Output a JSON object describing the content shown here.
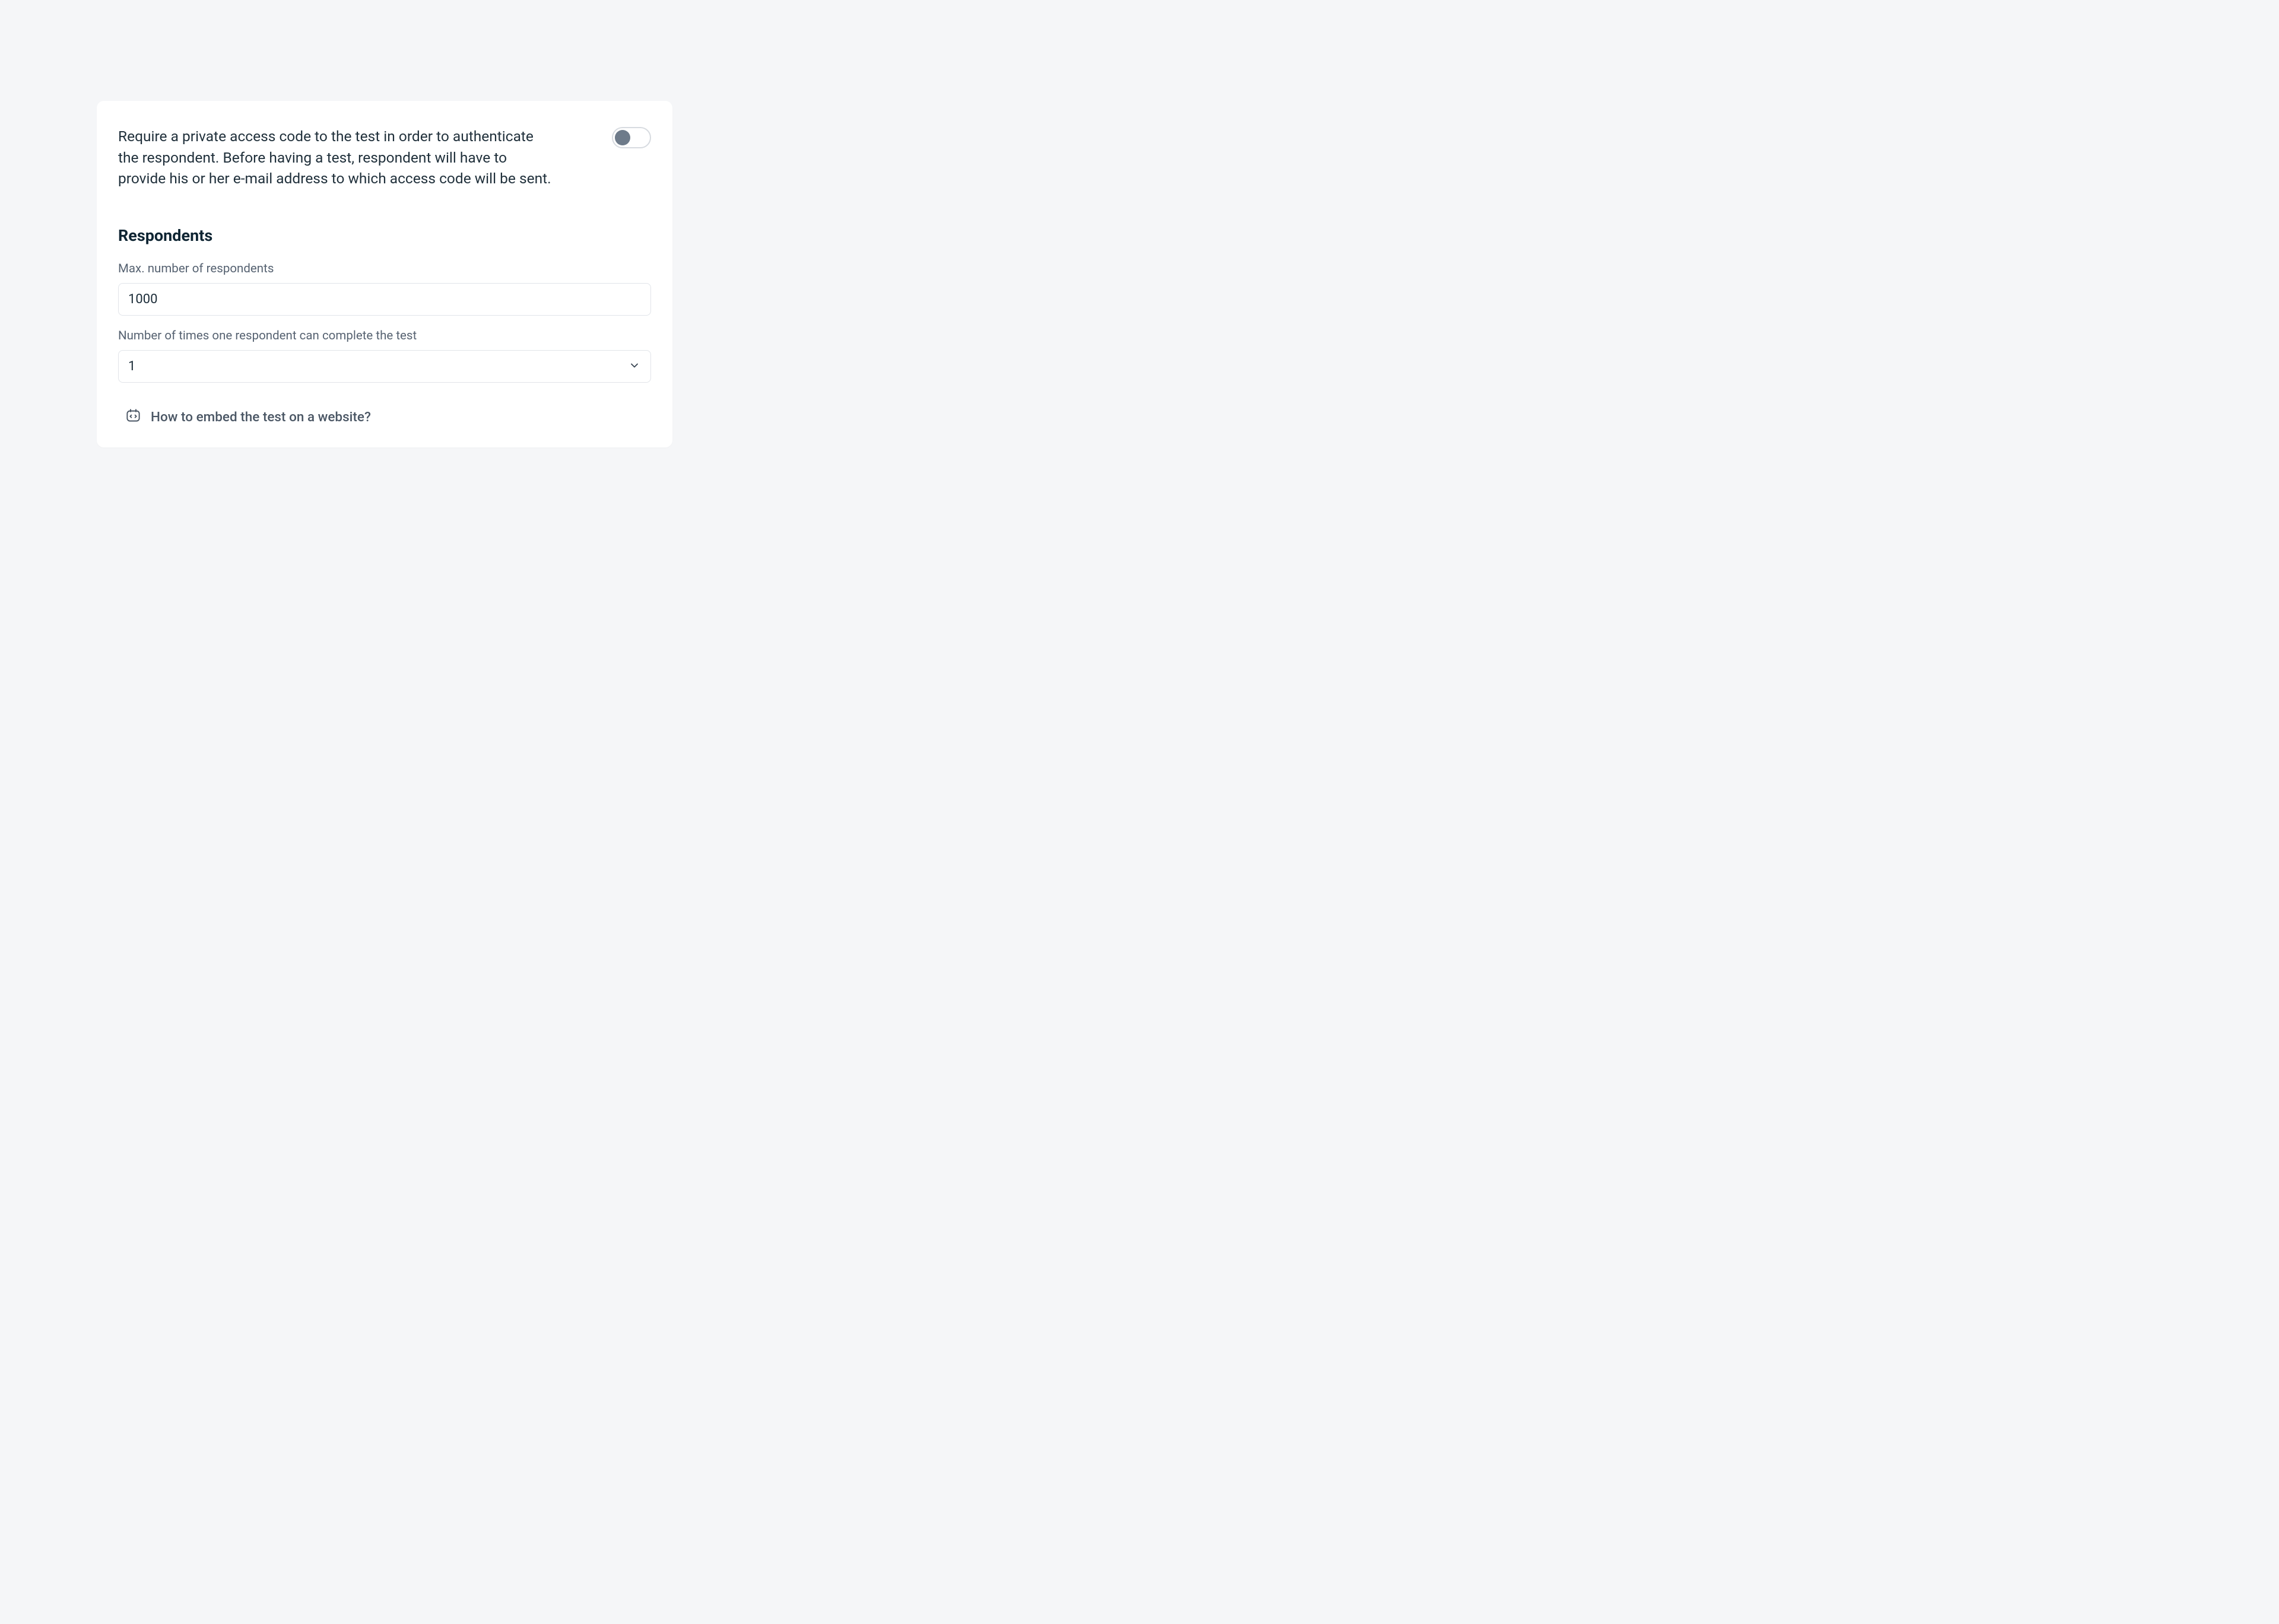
{
  "access_code": {
    "description": "Require a private access code to the test in order to authenticate the respondent. Before having a test, respondent will have to provide his or her e-mail address to which access code will be sent.",
    "toggle_on": false
  },
  "respondents": {
    "heading": "Respondents",
    "max_label": "Max. number of respondents",
    "max_value": "1000",
    "attempts_label": "Number of times one respondent can complete the test",
    "attempts_value": "1"
  },
  "embed": {
    "link_text": "How to embed the test on a website?"
  }
}
